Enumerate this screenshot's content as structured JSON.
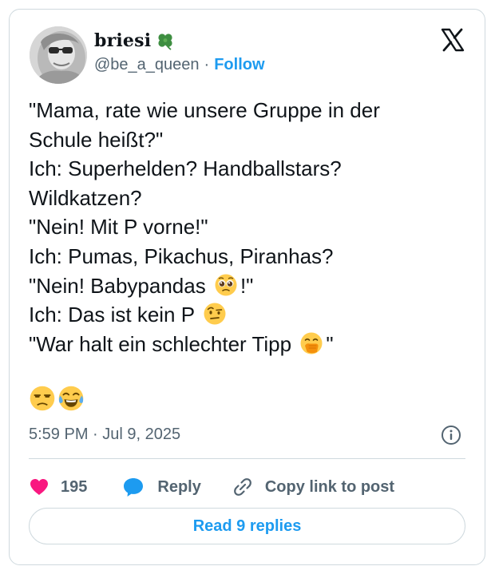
{
  "author": {
    "display_name": "briesi",
    "name_emoji": "four-leaf-clover",
    "handle": "@be_a_queen",
    "separator": "·",
    "follow_label": "Follow"
  },
  "brand": {
    "logo_icon": "x-logo",
    "text_color": "#0f1419",
    "muted_color": "#536471",
    "accent_color": "#1d9bf0",
    "like_color": "#f91880",
    "border_color": "#cfd9de"
  },
  "tweet": {
    "lines": [
      "\"Mama, rate wie unsere Gruppe in der",
      "Schule heißt?\"",
      "Ich: Superhelden? Handballstars?",
      "Wildkatzen?",
      "\"Nein! Mit P vorne!\"",
      "Ich: Pumas, Pikachus, Piranhas?",
      "\"Nein! Babypandas",
      "!\"",
      "Ich: Das ist kein P",
      "\"War halt ein schlechter Tipp",
      "\""
    ],
    "inline_emojis": [
      "pleading-face",
      "face-with-raised-eyebrow",
      "face-with-hand-over-mouth"
    ],
    "trailing_emojis": [
      "unamused-face",
      "face-with-tears-of-joy"
    ]
  },
  "meta": {
    "timestamp": "5:59 PM · Jul 9, 2025",
    "info_icon": "info-icon"
  },
  "actions": {
    "like_count": "195",
    "reply_label": "Reply",
    "copy_label": "Copy link to post"
  },
  "footer": {
    "read_replies_label": "Read 9 replies"
  }
}
